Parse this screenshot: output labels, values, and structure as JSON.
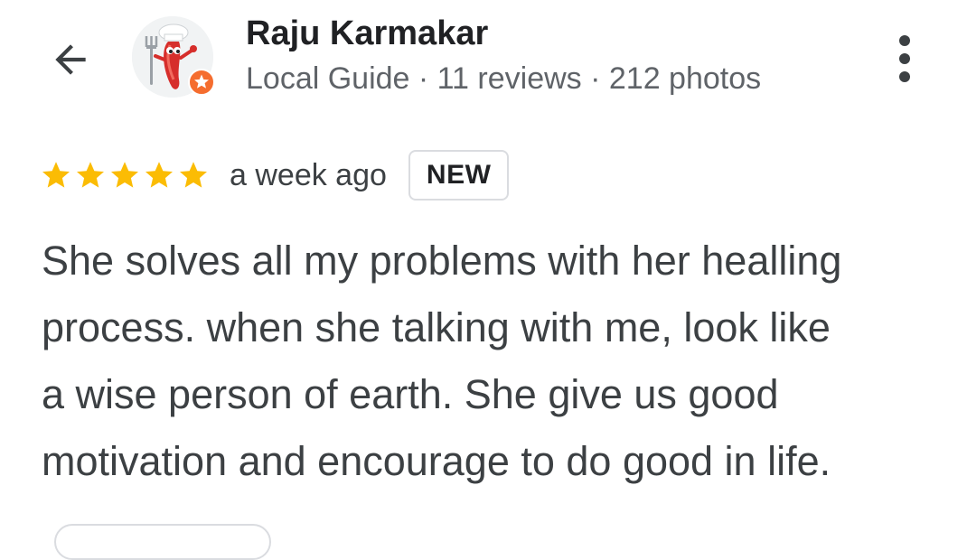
{
  "reviewer": {
    "name": "Raju Karmakar",
    "meta": "Local Guide · 11 reviews · 212 photos"
  },
  "review": {
    "rating": 5,
    "time": "a week ago",
    "badge": "NEW",
    "lines": [
      "She solves all my problems with her healling",
      "process. when she talking with me, look like",
      "a wise person of earth. She give us good",
      "motivation and encourage to do good in life."
    ]
  },
  "icons": {
    "back": "arrow-back-icon",
    "more": "more-vert-icon",
    "star": "star-icon",
    "guide_badge": "local-guide-badge-icon"
  },
  "colors": {
    "star": "#fbbc04",
    "guide_badge": "#f56d2f",
    "text_primary": "#202124",
    "text_secondary": "#5f6368",
    "body_text": "#3c4043"
  }
}
